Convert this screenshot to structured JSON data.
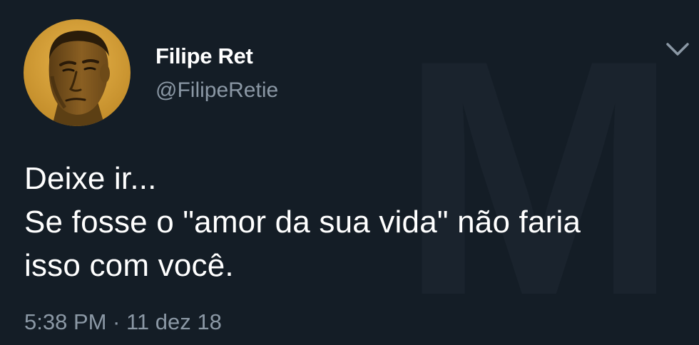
{
  "author": {
    "name": "Filipe Ret",
    "handle": "@FilipeRetie"
  },
  "tweet": {
    "lines": [
      "Deixe ir...",
      "Se fosse o \"amor da sua vida\" não faria",
      "isso com você."
    ],
    "timestamp": "5:38 PM · 11 dez 18"
  },
  "icons": {
    "menu": "chevron-down-icon",
    "avatar": "avatar-photo"
  },
  "colors": {
    "background": "#141d26",
    "primary_text": "#ffffff",
    "secondary_text": "#8b98a5",
    "avatar_tone": "#c9952e"
  }
}
